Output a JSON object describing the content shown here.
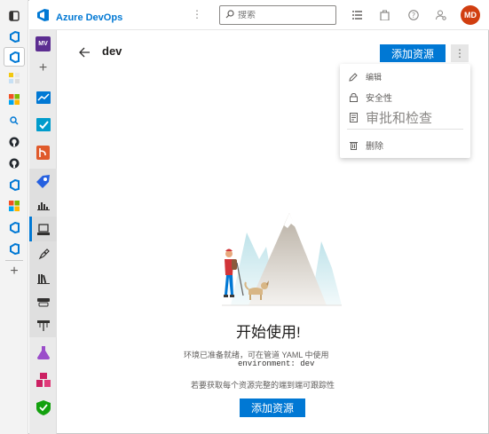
{
  "topbar": {
    "brand": "Azure DevOps",
    "search_placeholder": "搜索",
    "avatar_initials": "MD"
  },
  "nav": {
    "project_initials": "MV"
  },
  "page": {
    "title": "dev",
    "add_resource_label": "添加资源"
  },
  "menu": {
    "items": [
      {
        "label": "编辑",
        "icon": "pencil-icon"
      },
      {
        "label": "安全性",
        "icon": "lock-icon"
      },
      {
        "label": "审批和检查",
        "icon": "document-icon"
      },
      {
        "label": "删除",
        "icon": "trash-icon"
      }
    ]
  },
  "empty_state": {
    "title": "开始使用!",
    "line1": "环境已准备就绪，可在管道 YAML 中使用",
    "code": "environment: dev",
    "line2": "若要获取每个资源完整的端到端可跟踪性",
    "button_label": "添加资源"
  },
  "colors": {
    "accent": "#0078d4",
    "avatar": "#d13e10"
  }
}
